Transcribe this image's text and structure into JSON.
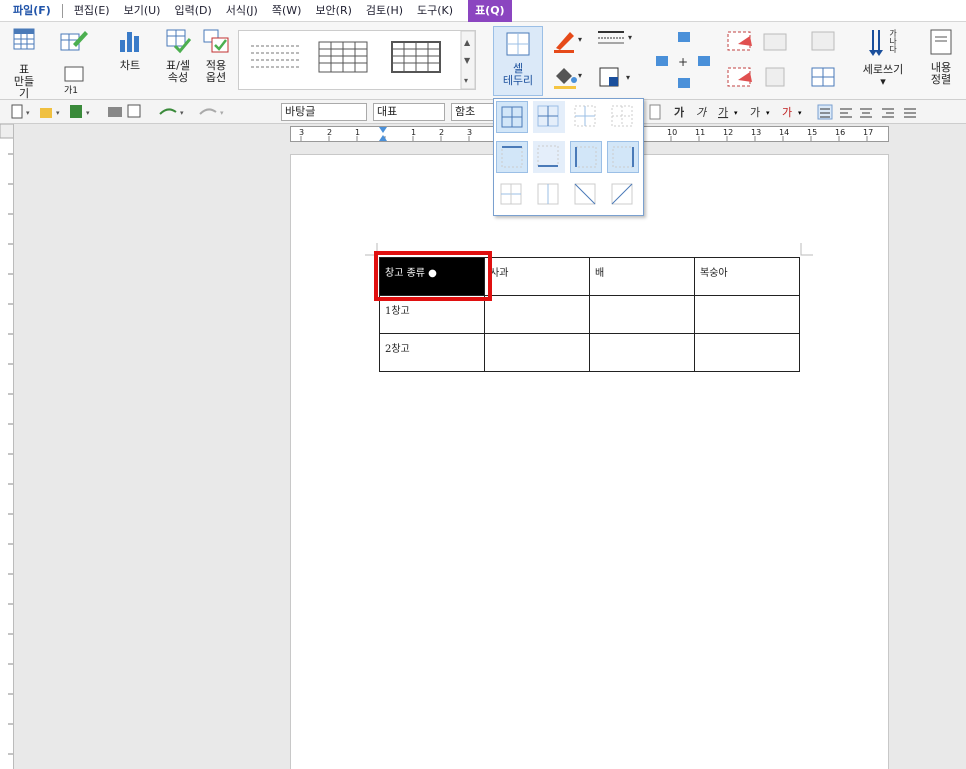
{
  "menu": [
    {
      "label": "파일(F)",
      "key": "file"
    },
    {
      "label": "편집(E)"
    },
    {
      "label": "보기(U)"
    },
    {
      "label": "입력(D)"
    },
    {
      "label": "서식(J)"
    },
    {
      "label": "쪽(W)"
    },
    {
      "label": "보안(R)"
    },
    {
      "label": "검토(H)"
    },
    {
      "label": "도구(K)"
    },
    {
      "label": "표(Q)",
      "key": "active"
    }
  ],
  "ribbon": {
    "table_make": "표",
    "table_make2": "만들기",
    "char_label": "가1",
    "chart": "차트",
    "table_props": "표/셀",
    "table_props2": "속성",
    "apply": "적용",
    "apply2": "옵션",
    "cell_border": "셀",
    "cell_border2": "테두리",
    "vertical_write": "세로쓰기",
    "content_align": "내용",
    "content_align2": "정렬",
    "vertical_glyph": "가나다"
  },
  "toolbar": {
    "style_combo": "바탕글",
    "font_combo": "대표",
    "font_name": "함초"
  },
  "ruler_numbers": [
    "3",
    "2",
    "1",
    "1",
    "2",
    "3",
    "10",
    "11",
    "12",
    "13",
    "14",
    "15",
    "16",
    "17"
  ],
  "table": {
    "rows": [
      [
        "창고 종류",
        "사과",
        "배",
        "복숭아"
      ],
      [
        "1창고",
        "",
        "",
        ""
      ],
      [
        "2창고",
        "",
        "",
        ""
      ]
    ]
  },
  "colors": {
    "accent": "#8b45c0",
    "highlight": "#e01010",
    "selection_bg": "#000000"
  }
}
